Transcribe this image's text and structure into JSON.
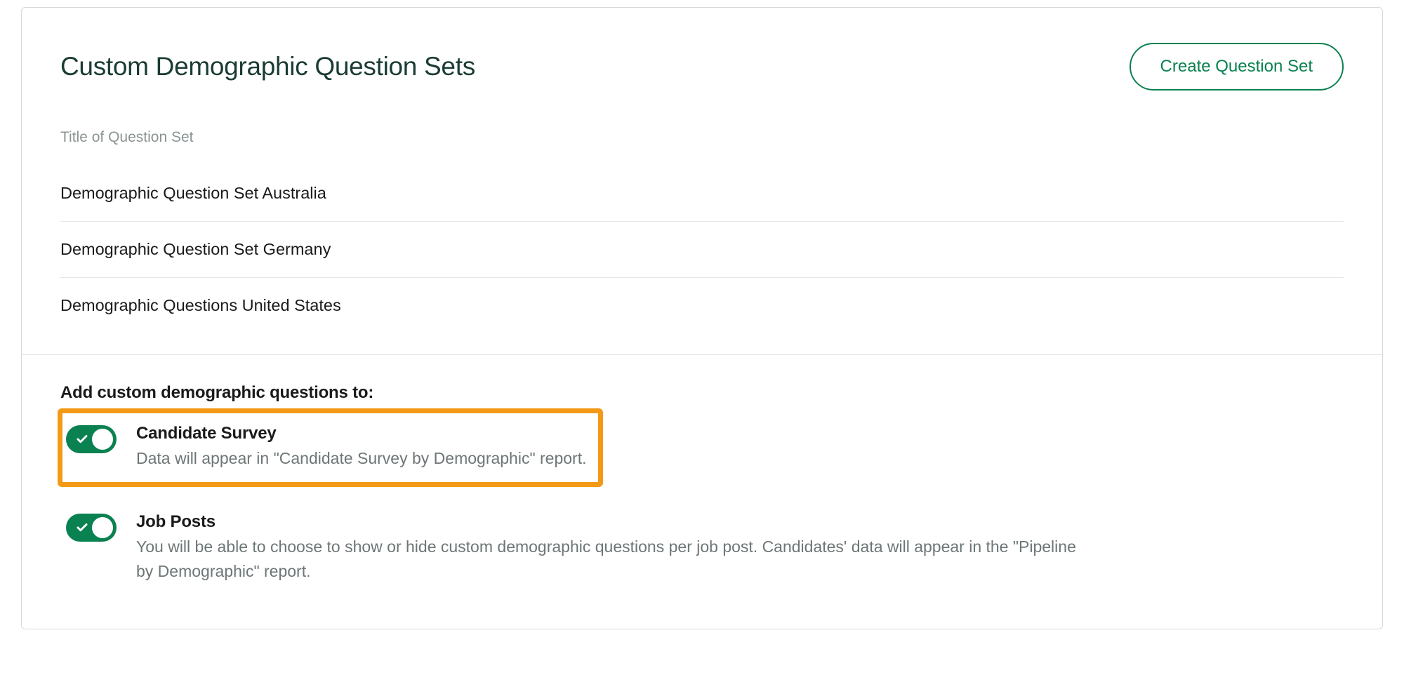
{
  "header": {
    "title": "Custom Demographic Question Sets",
    "create_button": "Create Question Set"
  },
  "list": {
    "label": "Title of Question Set",
    "items": [
      "Demographic Question Set Australia",
      "Demographic Question Set Germany",
      "Demographic Questions United States"
    ]
  },
  "settings": {
    "heading": "Add custom demographic questions to:",
    "rows": [
      {
        "title": "Candidate Survey",
        "desc": "Data will appear in \"Candidate Survey by Demographic\" report.",
        "on": true,
        "highlighted": true
      },
      {
        "title": "Job Posts",
        "desc": "You will be able to choose to show or hide custom demographic questions per job post. Candidates' data will appear in the \"Pipeline by Demographic\" report.",
        "on": true,
        "highlighted": false
      }
    ]
  }
}
